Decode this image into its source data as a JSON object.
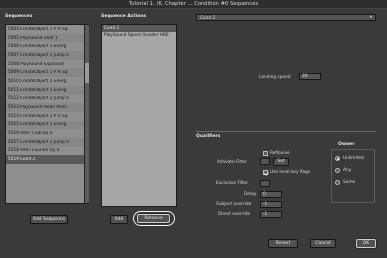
{
  "window": {
    "title": "Tutorial 1: (6. Chapter ... Condition #0 Sequences"
  },
  "sequences": {
    "header": "Sequences",
    "rows": [
      {
        "id": "5004",
        "name": "CreateObject 1 P R Sq"
      },
      {
        "id": "5005",
        "name": "PlaySound Shot 1"
      },
      {
        "id": "5006",
        "name": "CreateObject 1 Energ"
      },
      {
        "id": "5007",
        "name": "CreateObject 1 Jump 0"
      },
      {
        "id": "5008",
        "name": "PlaySound Explosion"
      },
      {
        "id": "5009",
        "name": "CreateObject 1 P R Sq"
      },
      {
        "id": "5010",
        "name": "CreateObject 1 Energ"
      },
      {
        "id": "5011",
        "name": "CreateObject 1 Energ"
      },
      {
        "id": "5012",
        "name": "CreateObject 1 Jump 0"
      },
      {
        "id": "5013",
        "name": "PlaySound Hello Alien"
      },
      {
        "id": "5014",
        "name": "CreateObject 1 P R Sq"
      },
      {
        "id": "5015",
        "name": "CreateObject 1 Energ"
      },
      {
        "id": "5016",
        "name": "Alter Crab by 0"
      },
      {
        "id": "5017",
        "name": "CreateObject 1 Jump 0"
      },
      {
        "id": "5018",
        "name": "Alter Counter by 0"
      },
      {
        "id": "5019",
        "name": "Cond 2"
      }
    ],
    "add_button": "Add Sequence"
  },
  "actions": {
    "header": "Sequence Actions",
    "rows": [
      "Cond 2",
      "PlaySound Space Invader HKE"
    ],
    "add_button": "Add",
    "remove_button": "Remove"
  },
  "action_type": {
    "value": "Cond 2"
  },
  "landing_speed": {
    "label": "Landing speed",
    "value": "30"
  },
  "qualifiers": {
    "header": "Qualifiers",
    "reflexive_label": "Reflexive",
    "activate_filter_label": "Activate Filter",
    "activate_filter_button": "Set",
    "use_level_key_label": "Use level key flags",
    "exclusive_filter_label": "Exclusive Filter",
    "delay_label": "Delay",
    "delay_value": "0",
    "subject_override_label": "Subject override",
    "subject_override_value": "-1",
    "direct_override_label": "Direct override",
    "direct_override_value": "-1",
    "reflexive_checked": false,
    "use_level_key_checked": true
  },
  "owner": {
    "header": "Owner",
    "options": [
      "Unlimited",
      "Any",
      "Same"
    ],
    "selected": "Unlimited"
  },
  "footer": {
    "revert": "Revert",
    "cancel": "Cancel",
    "ok": "OK"
  },
  "colors": {
    "window_bg": "#3a3a3a",
    "list_bg": "#8f8f8f",
    "selected_row": "#5a5a5a",
    "highlight_ring": "#f4f4f4"
  },
  "icons": {
    "scroll_up": "▲",
    "scroll_down": "▼",
    "dropdown_arrow": "▾"
  }
}
